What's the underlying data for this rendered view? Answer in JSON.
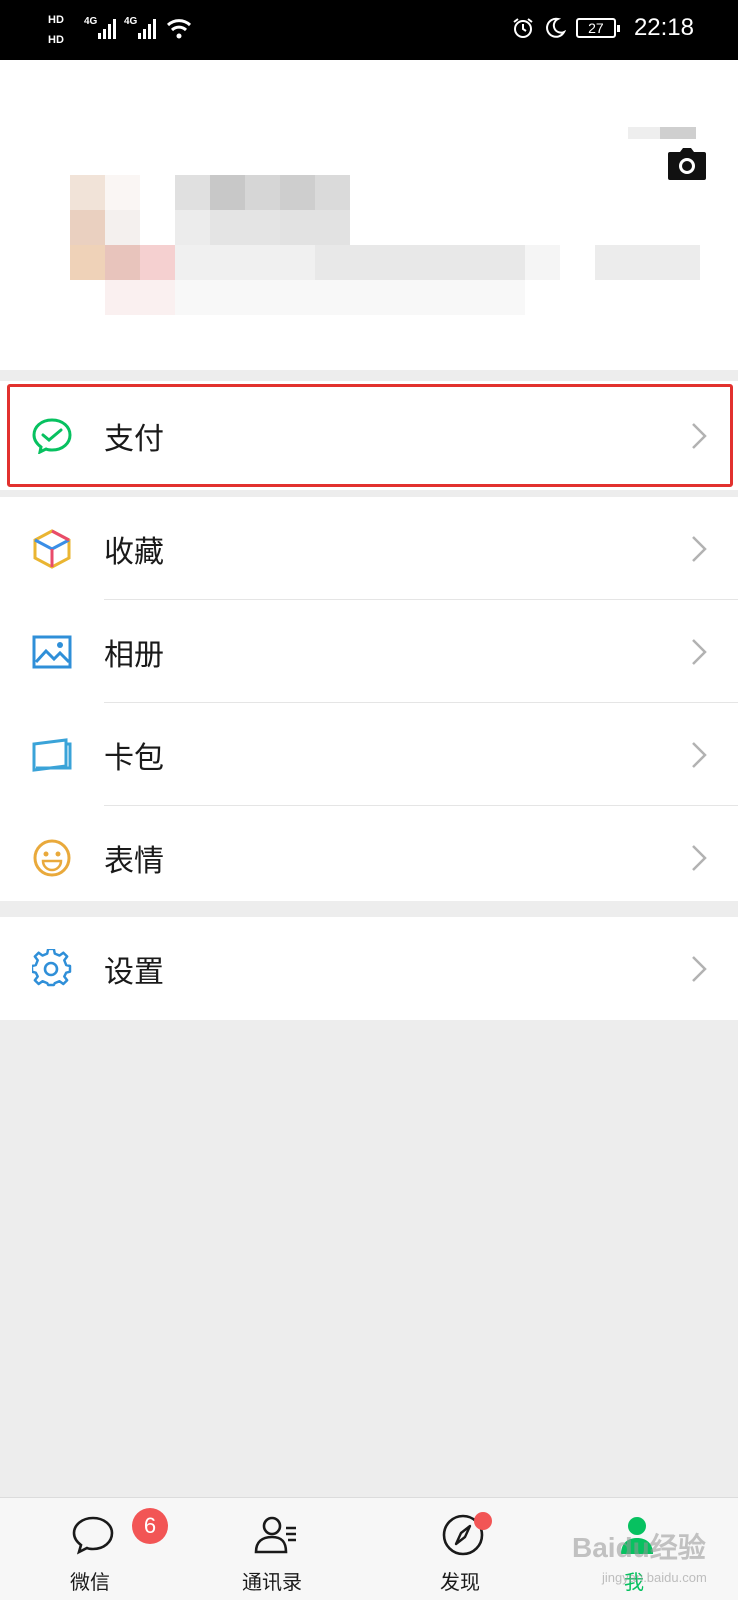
{
  "status_bar": {
    "hd1": "HD",
    "hd2": "HD",
    "net1": "4G",
    "net2": "4G",
    "battery": "27",
    "time": "22:18"
  },
  "profile": {
    "camera_icon": "camera-icon"
  },
  "menu": {
    "pay": {
      "label": "支付",
      "icon": "wechat-pay-icon"
    },
    "items": [
      {
        "label": "收藏",
        "icon": "favorites-cube-icon"
      },
      {
        "label": "相册",
        "icon": "album-icon"
      },
      {
        "label": "卡包",
        "icon": "card-wallet-icon"
      },
      {
        "label": "表情",
        "icon": "smiley-icon"
      }
    ],
    "settings": {
      "label": "设置",
      "icon": "gear-icon"
    }
  },
  "tabbar": {
    "tabs": [
      {
        "label": "微信",
        "icon": "chat-bubble-icon",
        "badge": "6"
      },
      {
        "label": "通讯录",
        "icon": "contacts-icon"
      },
      {
        "label": "发现",
        "icon": "compass-icon"
      },
      {
        "label": "我",
        "icon": "me-person-icon",
        "active": true
      }
    ]
  },
  "watermark": {
    "text": "Baidu经验",
    "sub": "jingyan.baidu.com"
  },
  "colors": {
    "accent_green": "#07c160",
    "highlight_red": "#e2312e",
    "badge_red": "#f25555"
  }
}
